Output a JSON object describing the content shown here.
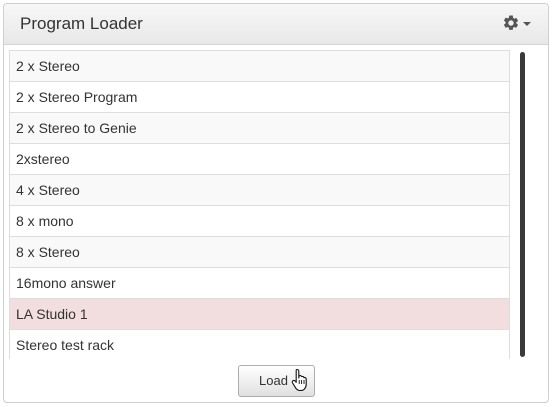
{
  "panel": {
    "title": "Program Loader",
    "settings_icon": "gear-icon",
    "dropdown_icon": "caret-down-icon"
  },
  "programs": [
    {
      "label": "2 x Stereo",
      "selected": false
    },
    {
      "label": "2 x Stereo Program",
      "selected": false
    },
    {
      "label": "2 x Stereo to Genie",
      "selected": false
    },
    {
      "label": "2xstereo",
      "selected": false
    },
    {
      "label": "4 x Stereo",
      "selected": false
    },
    {
      "label": "8 x mono",
      "selected": false
    },
    {
      "label": "8 x Stereo",
      "selected": false
    },
    {
      "label": "16mono answer",
      "selected": false
    },
    {
      "label": "LA Studio 1",
      "selected": true
    },
    {
      "label": "Stereo test rack",
      "selected": false
    }
  ],
  "footer": {
    "load_label": "Load"
  },
  "colors": {
    "selected_row": "#f2dede",
    "stripe_row": "#f9f9f9"
  }
}
